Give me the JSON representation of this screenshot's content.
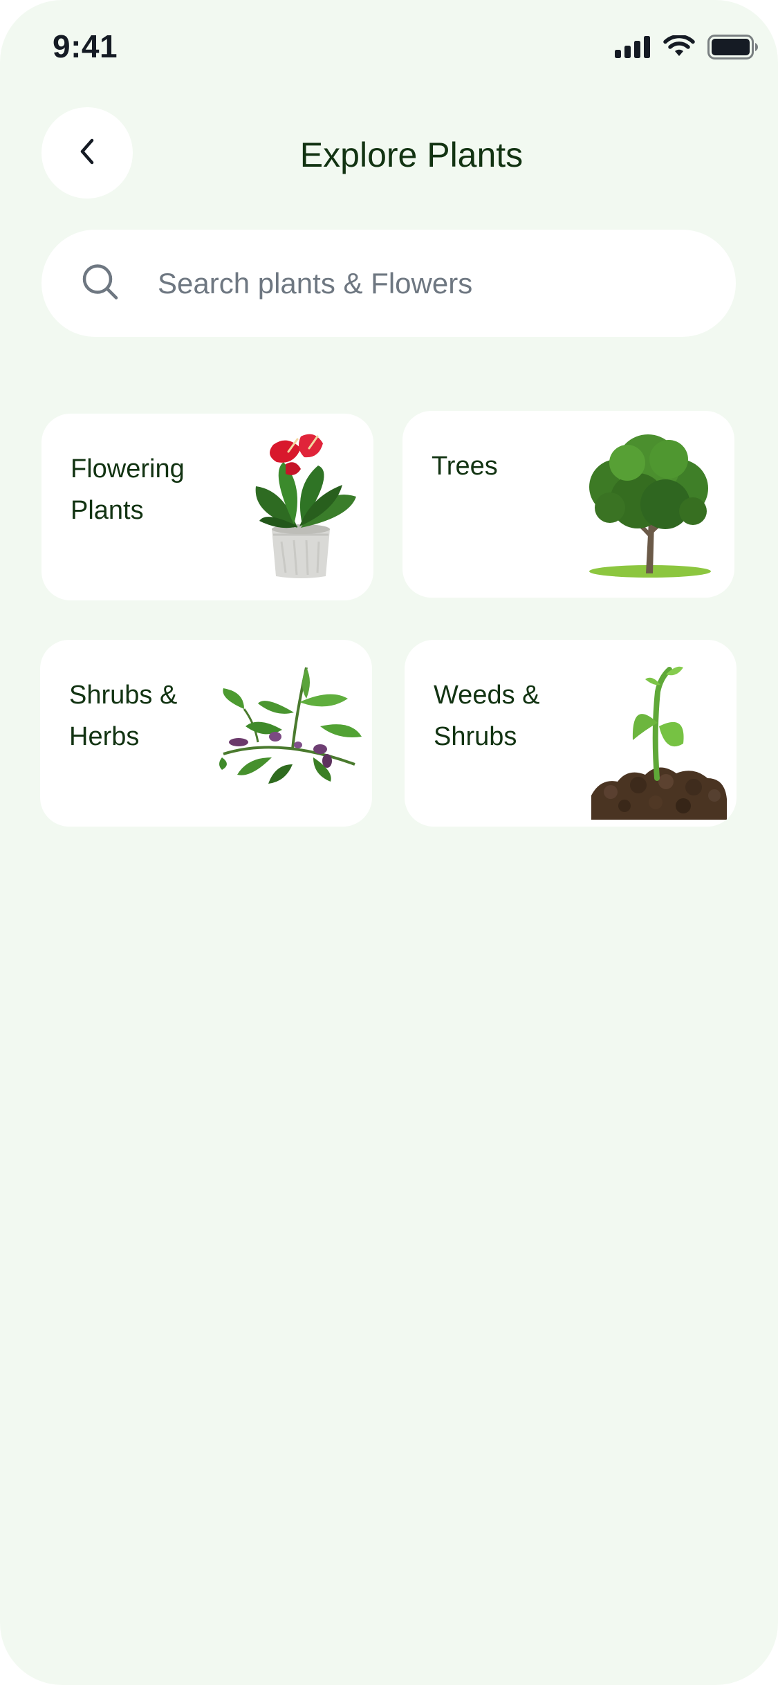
{
  "status_bar": {
    "time": "9:41",
    "icons": [
      "cellular-signal-icon",
      "wifi-icon",
      "battery-icon"
    ]
  },
  "header": {
    "title": "Explore Plants",
    "back_icon": "chevron-left-icon"
  },
  "search": {
    "placeholder": "Search plants & Flowers",
    "value": "",
    "icon": "search-icon"
  },
  "categories": [
    {
      "label": "Flowering\nPlants",
      "image": "potted-anthurium-icon"
    },
    {
      "label": "Trees",
      "image": "tree-icon"
    },
    {
      "label": "Shrubs &\nHerbs",
      "image": "herb-branch-icon"
    },
    {
      "label": "Weeds &\nShrubs",
      "image": "sprout-in-soil-icon"
    }
  ],
  "colors": {
    "background": "#f2f9f1",
    "surface": "#ffffff",
    "title_text": "#123312",
    "placeholder_text": "#6e7781",
    "leaf_green": "#3f8a2a",
    "flower_red": "#d8182c"
  }
}
